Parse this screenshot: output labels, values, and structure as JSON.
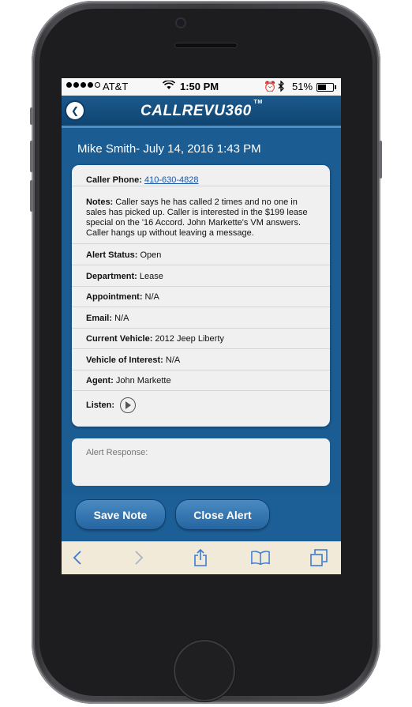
{
  "status_bar": {
    "carrier": "AT&T",
    "time": "1:50 PM",
    "battery": "51%",
    "icons": [
      "signal-dots",
      "wifi-icon",
      "alarm-icon",
      "bluetooth-icon",
      "battery-icon"
    ]
  },
  "header": {
    "logo_text": "CALLREVU360",
    "logo_tm": "TM",
    "back_icon": "chevron-left-icon"
  },
  "contact": {
    "title": "Mike Smith- July 14, 2016 1:43 PM"
  },
  "details": {
    "caller_phone_label": "Caller Phone:",
    "caller_phone_value": "410-630-4828",
    "notes_label": "Notes:",
    "notes_value": "Caller says he has called 2 times and no one in sales has picked up. Caller is interested in the $199 lease special on the '16 Accord. John Markette's VM answers. Caller hangs up without leaving a message.",
    "alert_status_label": "Alert Status:",
    "alert_status_value": "Open",
    "department_label": "Department:",
    "department_value": "Lease",
    "appointment_label": "Appointment:",
    "appointment_value": "N/A",
    "email_label": "Email:",
    "email_value": "N/A",
    "current_vehicle_label": "Current Vehicle:",
    "current_vehicle_value": "2012 Jeep Liberty",
    "vehicle_interest_label": "Vehicle of Interest:",
    "vehicle_interest_value": "N/A",
    "agent_label": "Agent:",
    "agent_value": "John Markette",
    "listen_label": "Listen:"
  },
  "response": {
    "placeholder": "Alert Response:"
  },
  "actions": {
    "save_label": "Save Note",
    "close_label": "Close Alert"
  },
  "toolbar": {
    "icons": [
      "back-icon",
      "forward-icon",
      "share-icon",
      "bookmarks-icon",
      "tabs-icon"
    ]
  },
  "colors": {
    "app_blue": "#1b5c92",
    "header_blue": "#0f4470",
    "link_blue": "#1a56a8",
    "card_gray": "#f0f0f0",
    "toolbar_tan": "#f2ead8"
  }
}
